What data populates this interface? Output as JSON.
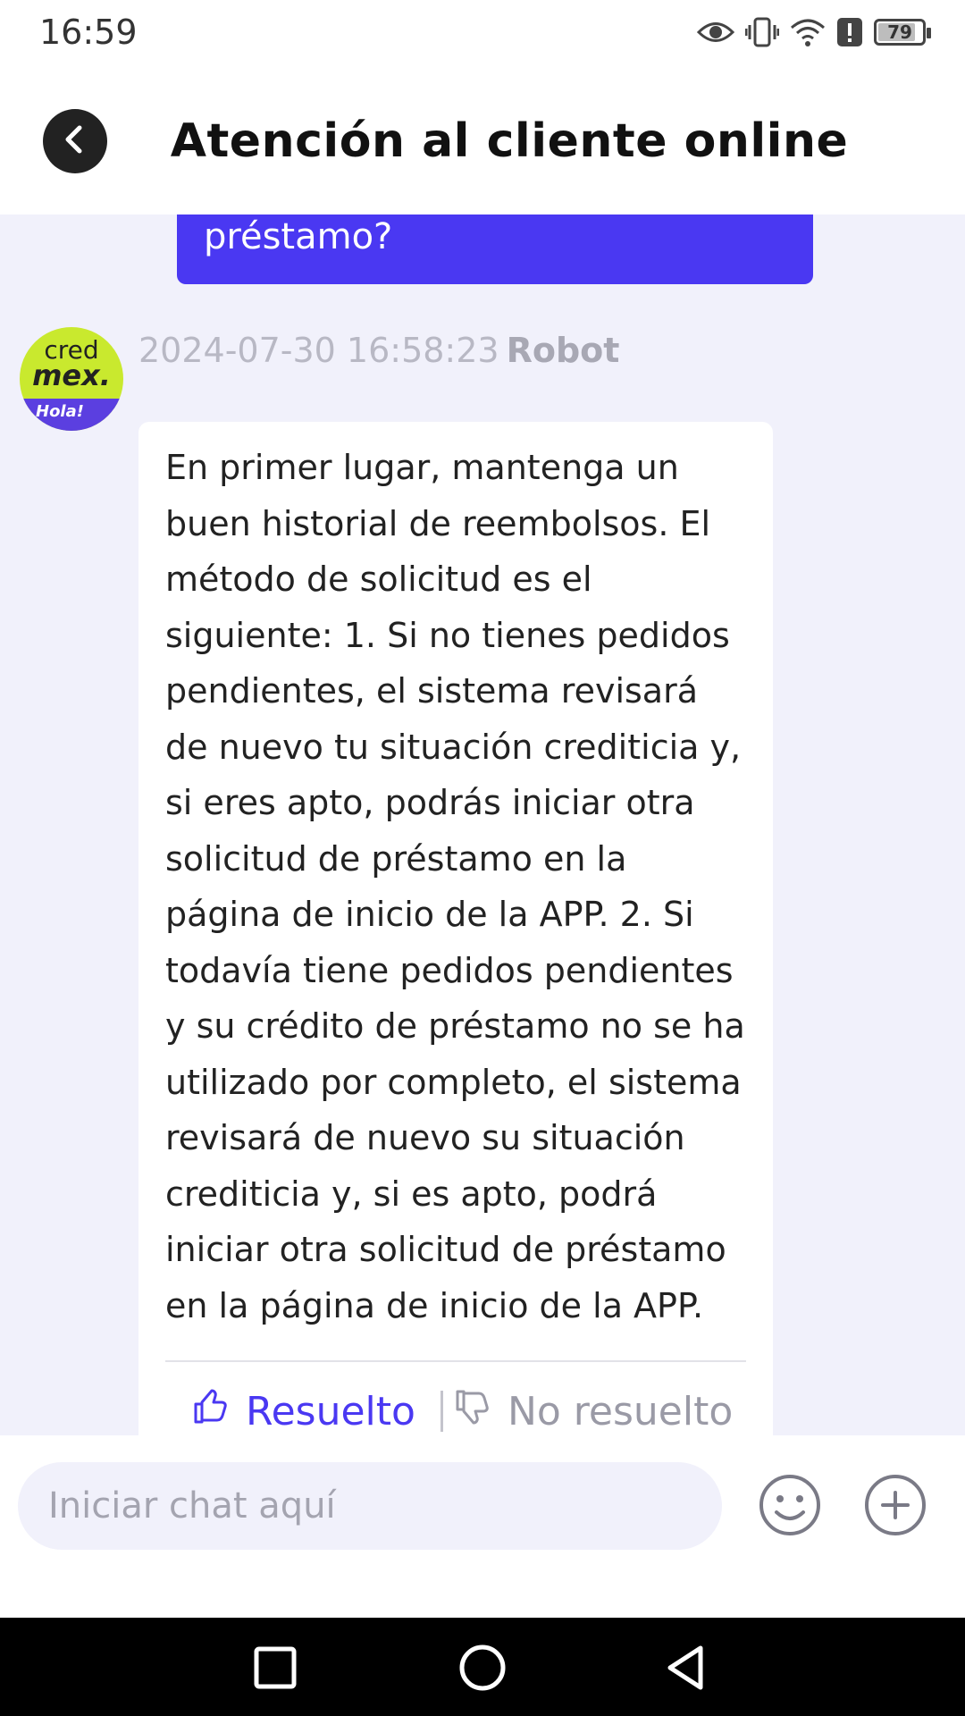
{
  "status_bar": {
    "time": "16:59",
    "battery": "79",
    "icons": [
      "eye-icon",
      "vibrate-icon",
      "wifi-icon",
      "alert-icon",
      "battery-icon"
    ]
  },
  "header": {
    "title": "Atención al cliente online",
    "back_icon": "chevron-left-icon"
  },
  "chat": {
    "user_message_tail": "préstamo?",
    "avatar": {
      "line1": "cred",
      "line2": "mex.",
      "tag": "Hola!"
    },
    "bot_message": {
      "timestamp": "2024-07-30 16:58:23",
      "sender": "Robot",
      "text": "En primer lugar, mantenga un buen historial de reembolsos. El método de solicitud es el siguiente: 1. Si no tienes pedidos pendientes, el sistema revisará de nuevo tu situación crediticia y, si eres apto, podrás iniciar otra solicitud de préstamo en la página de inicio de la APP. 2. Si todavía tiene pedidos pendientes y su crédito de préstamo no se ha utilizado por completo, el sistema revisará de nuevo su situación crediticia y, si es apto, podrá iniciar otra solicitud de préstamo en la página de inicio de la APP.",
      "feedback": {
        "resolved": "Resuelto",
        "unresolved": "No resuelto"
      }
    }
  },
  "input": {
    "placeholder": "Iniciar chat aquí",
    "value": ""
  },
  "colors": {
    "accent": "#4a38f2",
    "chat_bg": "#f1f1fb"
  }
}
